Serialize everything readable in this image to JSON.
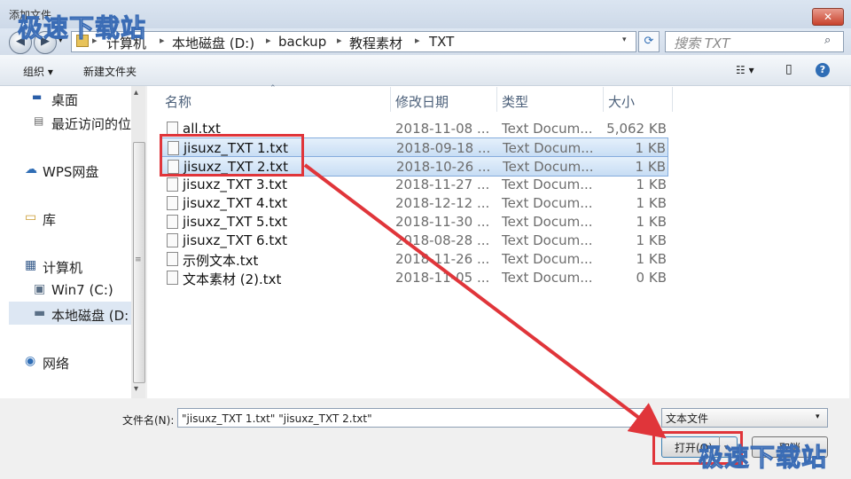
{
  "window": {
    "title": "添加文件",
    "close": "✕"
  },
  "nav": {
    "back": "◀",
    "forward": "▶",
    "history": "▾"
  },
  "address": {
    "crumbs": [
      "计算机",
      "本地磁盘 (D:)",
      "backup",
      "教程素材",
      "TXT"
    ],
    "sep": "▸",
    "dropdown": "▾",
    "refresh": "⟳"
  },
  "search": {
    "placeholder": "搜索 TXT",
    "icon": "⌕"
  },
  "toolbar": {
    "organize": "组织 ▾",
    "new_folder": "新建文件夹",
    "view_icon": "☷ ▾",
    "pane_icon": "▯",
    "help_icon": "?"
  },
  "sidebar": {
    "items": [
      {
        "icon": "▬",
        "label": "桌面"
      },
      {
        "icon": "▤",
        "label": "最近访问的位"
      },
      {
        "icon": "☁",
        "label": "WPS网盘"
      },
      {
        "icon": "▭",
        "label": "库"
      },
      {
        "icon": "▦",
        "label": "计算机"
      },
      {
        "icon": "▣",
        "label": "Win7 (C:)"
      },
      {
        "icon": "▬",
        "label": "本地磁盘 (D:"
      },
      {
        "icon": "◉",
        "label": "网络"
      }
    ],
    "scroll_up": "▴",
    "scroll_down": "▾",
    "grip": "≡"
  },
  "columns": {
    "name": "名称",
    "date": "修改日期",
    "type": "类型",
    "size": "大小",
    "sort": "⌃"
  },
  "files": [
    {
      "name": "all.txt",
      "date": "2018-11-08 ...",
      "type": "Text Docum...",
      "size": "5,062 KB",
      "selected": false
    },
    {
      "name": "jisuxz_TXT 1.txt",
      "date": "2018-09-18 ...",
      "type": "Text Docum...",
      "size": "1 KB",
      "selected": true
    },
    {
      "name": "jisuxz_TXT 2.txt",
      "date": "2018-10-26 ...",
      "type": "Text Docum...",
      "size": "1 KB",
      "selected": true
    },
    {
      "name": "jisuxz_TXT 3.txt",
      "date": "2018-11-27 ...",
      "type": "Text Docum...",
      "size": "1 KB",
      "selected": false
    },
    {
      "name": "jisuxz_TXT 4.txt",
      "date": "2018-12-12 ...",
      "type": "Text Docum...",
      "size": "1 KB",
      "selected": false
    },
    {
      "name": "jisuxz_TXT 5.txt",
      "date": "2018-11-30 ...",
      "type": "Text Docum...",
      "size": "1 KB",
      "selected": false
    },
    {
      "name": "jisuxz_TXT 6.txt",
      "date": "2018-08-28 ...",
      "type": "Text Docum...",
      "size": "1 KB",
      "selected": false
    },
    {
      "name": "示例文本.txt",
      "date": "2018-11-26 ...",
      "type": "Text Docum...",
      "size": "1 KB",
      "selected": false
    },
    {
      "name": "文本素材 (2).txt",
      "date": "2018-11-05 ...",
      "type": "Text Docum...",
      "size": "0 KB",
      "selected": false
    }
  ],
  "bottom": {
    "filename_label": "文件名(N):",
    "filename_value": "\"jisuxz_TXT 1.txt\" \"jisuxz_TXT 2.txt\"",
    "filetype": "文本文件",
    "filetype_arrow": "▾",
    "open": "打开(O)",
    "open_arrow": "▾",
    "cancel": "取消"
  },
  "watermark": "极速下载站",
  "colors": {
    "highlight": "#e0353a",
    "selection": "#c7ddf4"
  }
}
